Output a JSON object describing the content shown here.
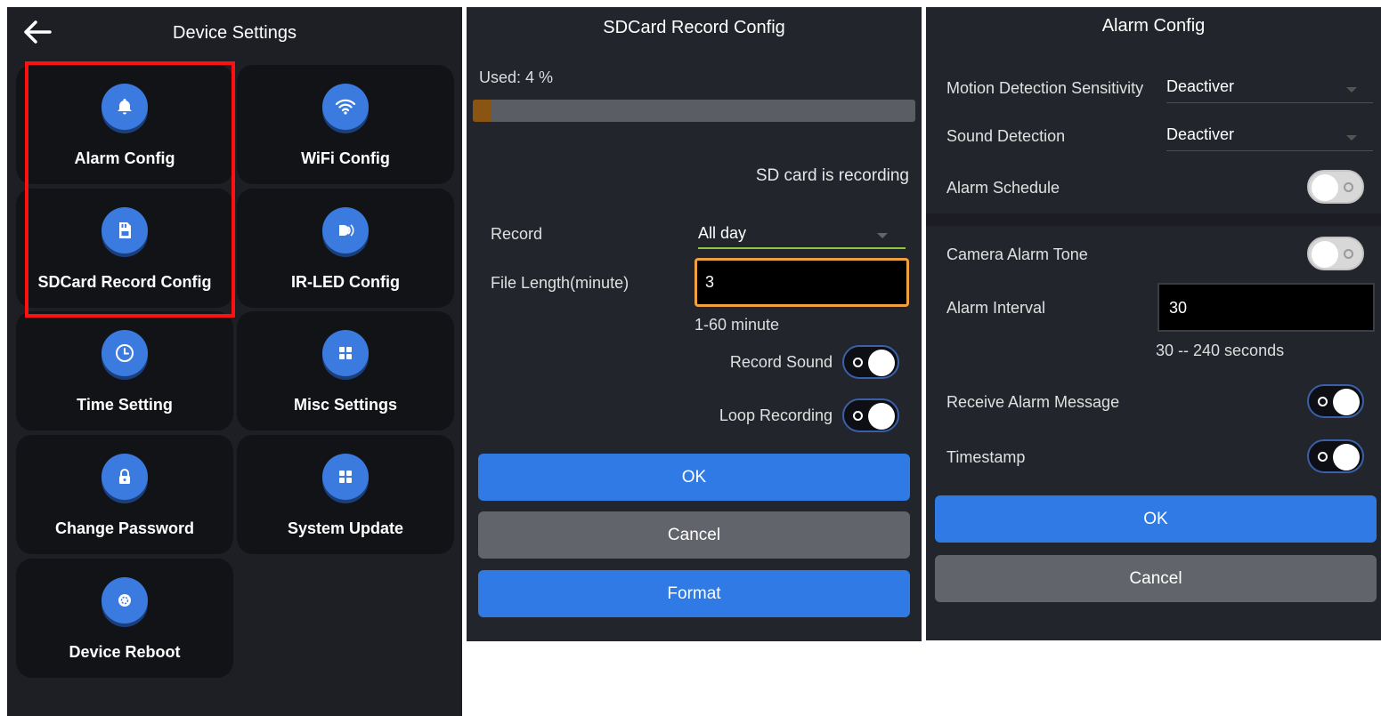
{
  "device_settings": {
    "title": "Device Settings",
    "tiles": [
      {
        "label": "Alarm Config",
        "icon": "bell-icon"
      },
      {
        "label": "WiFi Config",
        "icon": "wifi-icon"
      },
      {
        "label": "SDCard Record Config",
        "icon": "sdcard-icon"
      },
      {
        "label": "IR-LED Config",
        "icon": "ir-led-icon"
      },
      {
        "label": "Time Setting",
        "icon": "clock-icon"
      },
      {
        "label": "Misc Settings",
        "icon": "grid-icon"
      },
      {
        "label": "Change Password",
        "icon": "lock-icon"
      },
      {
        "label": "System Update",
        "icon": "grid-icon"
      },
      {
        "label": "Device Reboot",
        "icon": "reboot-icon"
      }
    ],
    "highlight_color": "#ff1010"
  },
  "sdcard_config": {
    "title": "SDCard Record Config",
    "used_label": "Used: 4 %",
    "used_fraction": 0.04,
    "status": "SD card is recording",
    "record_label": "Record",
    "record_value": "All day",
    "file_length_label": "File Length(minute)",
    "file_length_value": "3",
    "file_length_hint": "1-60 minute",
    "record_sound_label": "Record Sound",
    "record_sound_on": true,
    "loop_recording_label": "Loop Recording",
    "loop_recording_on": true,
    "ok_label": "OK",
    "cancel_label": "Cancel",
    "format_label": "Format"
  },
  "alarm_config": {
    "title": "Alarm Config",
    "motion_label": "Motion Detection Sensitivity",
    "motion_value": "Deactiver",
    "sound_label": "Sound Detection",
    "sound_value": "Deactiver",
    "schedule_label": "Alarm Schedule",
    "schedule_on": false,
    "tone_label": "Camera Alarm Tone",
    "tone_on": false,
    "interval_label": "Alarm Interval",
    "interval_value": "30",
    "interval_hint": "30 -- 240 seconds",
    "receive_label": "Receive Alarm Message",
    "receive_on": true,
    "timestamp_label": "Timestamp",
    "timestamp_on": true,
    "ok_label": "OK",
    "cancel_label": "Cancel"
  },
  "colors": {
    "accent_blue": "#2f7ae5",
    "panel_bg": "#22252c",
    "input_focus": "#f0a040",
    "select_underline": "#8ec63f"
  }
}
